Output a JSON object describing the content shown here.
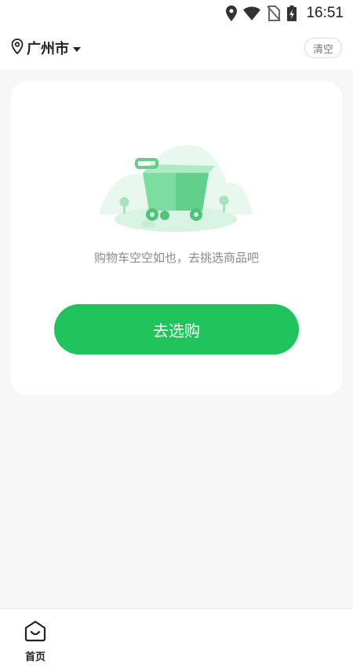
{
  "status_bar": {
    "time": "16:51",
    "icons": [
      "location-icon",
      "wifi-icon",
      "no-sim-icon",
      "battery-charging-icon"
    ]
  },
  "header": {
    "city": "广州市",
    "clear_label": "清空"
  },
  "cart": {
    "empty_message": "购物车空空如也，去挑选商品吧",
    "shop_button_label": "去选购",
    "illustration": "empty-cart-illustration"
  },
  "bottom_nav": {
    "items": [
      {
        "label": "首页",
        "icon": "home-icon"
      }
    ]
  },
  "colors": {
    "accent": "#1fc45c",
    "background": "#f7f7f7",
    "card": "#ffffff"
  }
}
